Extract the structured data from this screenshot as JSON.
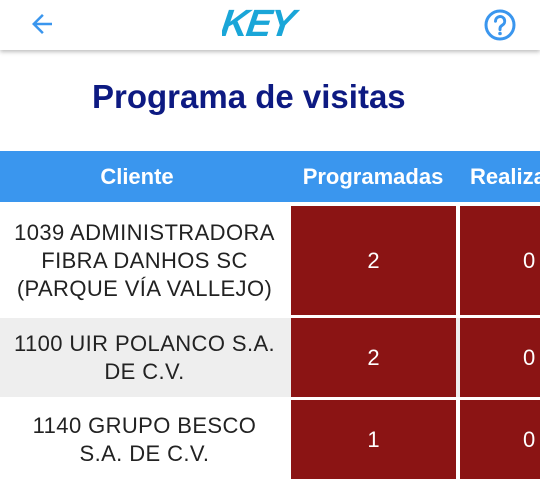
{
  "colors": {
    "accent": "#3a96ee",
    "title": "#0d1a82",
    "cell_bg": "#8b1414",
    "row_alt": "#eeeeee",
    "logo": "#1aa6d8"
  },
  "appbar": {
    "back_icon": "arrow-left-icon",
    "logo_text": "KEY",
    "help_icon": "question-circle-icon"
  },
  "page": {
    "title": "Programa de visitas"
  },
  "table": {
    "headers": {
      "cliente": "Cliente",
      "programadas": "Programadas",
      "realizadas": "Realiza"
    },
    "rows": [
      {
        "cliente": "1039   ADMINISTRADORA\nFIBRA DANHOS SC\n(PARQUE VÍA VALLEJO)",
        "programadas": "2",
        "realizadas": "0"
      },
      {
        "cliente": "1100   UIR POLANCO S.A.\nDE C.V.",
        "programadas": "2",
        "realizadas": "0"
      },
      {
        "cliente": "1140   GRUPO BESCO\nS.A. DE C.V.",
        "programadas": "1",
        "realizadas": "0"
      }
    ]
  }
}
